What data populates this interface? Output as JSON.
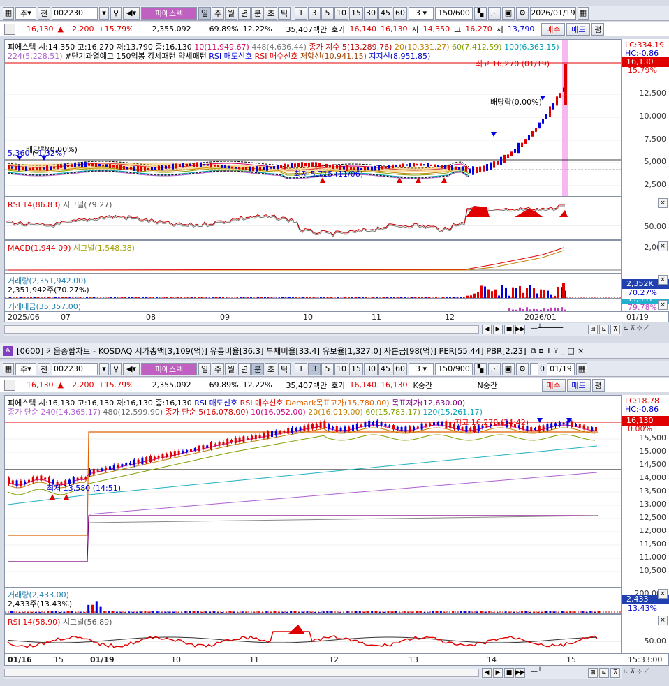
{
  "top": {
    "toolbar": {
      "type": "주",
      "period": "전",
      "code": "002230",
      "stock": "피에스텍",
      "intervals": [
        "일",
        "주",
        "월",
        "년",
        "분",
        "초",
        "틱"
      ],
      "nums": [
        "1",
        "3",
        "5",
        "10",
        "15",
        "30",
        "45",
        "60"
      ],
      "unit": "3",
      "count": "150/600",
      "date": "2026/01/19"
    },
    "quote": {
      "price": "16,130",
      "change": "2,200",
      "rate": "+15.79%",
      "volume": "2,355,092",
      "ratio1": "69.89%",
      "ratio2": "12.22%",
      "amount": "35,407백만",
      "bidlabel": "호가",
      "bid1": "16,140",
      "bid2": "16,130",
      "openlabel": "시",
      "open": "14,350",
      "highlabel": "고",
      "high": "16,270",
      "lowlabel": "저",
      "low": "13,790",
      "buy": "매수",
      "sell": "매도",
      "flat": "평"
    },
    "price_legend": {
      "name": "피에스텍",
      "ohlc": "시:14,350 고:16,270 저:13,790 종:16,130",
      "ma10": "10(11,949.67)",
      "ma448": "448(4,636.44)",
      "ma5": "종가 지수 5(13,289.76)",
      "ma20": "20(10,331.27)",
      "ma60": "60(7,412.59)",
      "ma100": "100(6,363.15)",
      "ma224": "224(5,228.51)",
      "warn": "#단기과열예고",
      "pattern": "150억봉 강세패턴",
      "weak": "약세패턴",
      "rsisell": "RSI 매도신호",
      "rsibuy": "RSI 매수신호",
      "resist": "저항선(10,941.15)",
      "support": "지지선(8,951.85)"
    },
    "annotations": {
      "high": "최고 16,270 (01/19)",
      "low": "최저 5,715 (11/06)",
      "div1": "배당락(0.00%)",
      "div2": "배당락(0.00%)",
      "left": "5,360",
      "leftpct": "(-1.32%)"
    },
    "price_axis": {
      "lc": "LC:334.19",
      "hc": "HC:-0.86",
      "cur": "16,130",
      "pct": "15.79%",
      "ticks": [
        "12,500",
        "10,000",
        "7,500",
        "5,000",
        "2,500"
      ]
    },
    "rsi": {
      "label": "RSI 14(86.83)",
      "signal": "시그널(79.27)",
      "tick": "50.00"
    },
    "macd": {
      "label": "MACD(1,944.09)",
      "signal": "시그널(1,548.38)",
      "tick": "2,000"
    },
    "volume": {
      "label": "거래량(2,351,942.00)",
      "sub": "2,351,942주(70.27%)",
      "cur": "2,352K",
      "pct": "70.27%"
    },
    "amount": {
      "label": "거래대금(35,357.00)",
      "cur": "35,357",
      "pct": "79.78%"
    },
    "xaxis": [
      "2025/06",
      "07",
      "08",
      "09",
      "10",
      "11",
      "12",
      "2026/01",
      "01/19"
    ]
  },
  "bottom": {
    "title": "[0600] 키움종합차트 - KOSDAQ 시가총액[3,109(억)] 유통비율[36.3] 부채비율[33.4] 유보율[1,327.0] 자본금[98(억)] PER[55.44] PBR[2.23]",
    "toolbar": {
      "type": "주",
      "period": "전",
      "code": "002230",
      "stock": "피에스텍",
      "intervals": [
        "일",
        "주",
        "월",
        "년",
        "분",
        "초",
        "틱"
      ],
      "nums": [
        "1",
        "3",
        "5",
        "10",
        "15",
        "30",
        "45",
        "60"
      ],
      "unit": "3",
      "count": "150/900",
      "zero": "0",
      "date": "01/19"
    },
    "quote": {
      "price": "16,130",
      "change": "2,200",
      "rate": "+15.79%",
      "volume": "2,355,092",
      "ratio1": "69.89%",
      "ratio2": "12.22%",
      "amount": "35,407백만",
      "bidlabel": "호가",
      "bid1": "16,140",
      "bid2": "16,130",
      "k": "K중간",
      "n": "N중간",
      "buy": "매수",
      "sell": "매도",
      "flat": "평"
    },
    "price_legend": {
      "name": "피에스텍",
      "ohlc": "시:16,130 고:16,130 저:16,130 종:16,130",
      "rsisell": "RSI 매도신호",
      "rsibuy": "RSI 매수신호",
      "demark_hi": "Demark목표고가(15,780.00)",
      "demark_lo": "목표저가(12,630.00)",
      "ma240": "종가 단순 240(14,365.17)",
      "ma480": "480(12,599.90)",
      "ma5": "종가 단순 5(16,078.00)",
      "ma10": "10(16,052.00)",
      "ma20": "20(16,019.00)",
      "ma60": "60(15,783.17)",
      "ma120": "120(15,261.17)"
    },
    "annotations": {
      "high": "최고 16,270 (14:42)",
      "low": "최저 13,580 (14:51)"
    },
    "price_axis": {
      "lc": "LC:18.78",
      "hc": "HC:-0.86",
      "cur": "16,130",
      "pct": "0.00%",
      "ticks": [
        "15,500",
        "15,000",
        "14,500",
        "14,000",
        "13,500",
        "13,000",
        "12,500",
        "12,000",
        "11,500",
        "11,000",
        "10,500"
      ]
    },
    "volume": {
      "label": "거래량(2,433.00)",
      "sub": "2,433주(13.43%)",
      "tick": "200,000",
      "cur": "2,433",
      "pct": "13.43%"
    },
    "rsi": {
      "label": "RSI 14(58.90)",
      "signal": "시그널(56.89)",
      "tick": "50.00"
    },
    "xaxis": [
      "01/16",
      "15",
      "01/19",
      "10",
      "11",
      "12",
      "13",
      "14",
      "15",
      "15:33:00"
    ]
  },
  "colors": {
    "up": "#e00000",
    "down": "#0000e0",
    "accent": "#c050c0"
  }
}
